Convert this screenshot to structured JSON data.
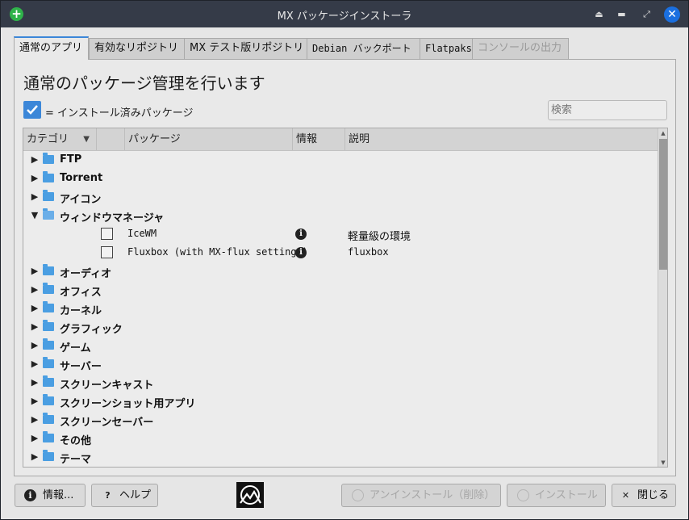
{
  "window": {
    "title": "MX パッケージインストーラ"
  },
  "tabs": [
    {
      "label": "通常のアプリ",
      "state": "active"
    },
    {
      "label": "有効なリポジトリ",
      "state": "normal"
    },
    {
      "label": "MX テスト版リポジトリ",
      "state": "normal"
    },
    {
      "label": "Debian バックポート",
      "state": "normal"
    },
    {
      "label": "Flatpaks",
      "state": "normal"
    },
    {
      "label": "コンソールの出力",
      "state": "disabled"
    }
  ],
  "main": {
    "heading": "通常のパッケージ管理を行います",
    "legend": "= インストール済みパッケージ",
    "search_placeholder": "検索"
  },
  "table": {
    "columns": [
      "カテゴリ",
      "",
      "パッケージ",
      "情報",
      "説明"
    ],
    "rows": [
      {
        "type": "category",
        "label": "FTP",
        "expanded": false
      },
      {
        "type": "category",
        "label": "Torrent",
        "expanded": false
      },
      {
        "type": "category",
        "label": "アイコン",
        "expanded": false
      },
      {
        "type": "category",
        "label": "ウィンドウマネージャ",
        "expanded": true
      },
      {
        "type": "package",
        "name": "IceWM",
        "description": "軽量級の環境",
        "checked": false
      },
      {
        "type": "package",
        "name": "Fluxbox (with MX-flux settings)",
        "description": "fluxbox",
        "checked": false
      },
      {
        "type": "category",
        "label": "オーディオ",
        "expanded": false
      },
      {
        "type": "category",
        "label": "オフィス",
        "expanded": false
      },
      {
        "type": "category",
        "label": "カーネル",
        "expanded": false
      },
      {
        "type": "category",
        "label": "グラフィック",
        "expanded": false
      },
      {
        "type": "category",
        "label": "ゲーム",
        "expanded": false
      },
      {
        "type": "category",
        "label": "サーバー",
        "expanded": false
      },
      {
        "type": "category",
        "label": "スクリーンキャスト",
        "expanded": false
      },
      {
        "type": "category",
        "label": "スクリーンショット用アプリ",
        "expanded": false
      },
      {
        "type": "category",
        "label": "スクリーンセーバー",
        "expanded": false
      },
      {
        "type": "category",
        "label": "その他",
        "expanded": false
      },
      {
        "type": "category",
        "label": "テーマ",
        "expanded": false
      }
    ]
  },
  "buttons": {
    "info": "情報...",
    "help": "ヘルプ",
    "uninstall": "アンインストール（削除）",
    "install": "インストール",
    "close": "閉じる"
  },
  "colors": {
    "accent": "#3c87d8",
    "titlebar": "#353b48",
    "close_button": "#1a6fe0",
    "add_button": "#2fb34a"
  }
}
